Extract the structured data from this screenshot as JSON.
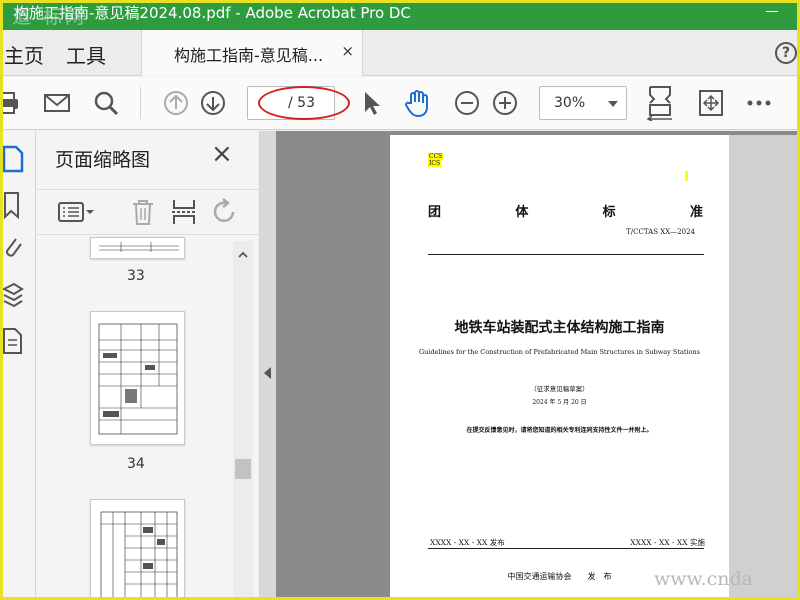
{
  "window": {
    "title": "构施工指南-意见稿2024.08.pdf - Adobe Acrobat Pro DC",
    "watermark_top": "道 标网",
    "title_bar_color": "#2e9c3e"
  },
  "nav": {
    "home_label": "主页",
    "tools_label": "工具",
    "doc_tab_label": "构施工指南-意见稿...",
    "doc_tab_close": "×",
    "help_label": "?"
  },
  "toolbar": {
    "page_current": "",
    "page_total": "/ 53",
    "zoom_value": "30%",
    "icons": [
      "print-icon",
      "email-icon",
      "search-icon",
      "prev-page-icon",
      "next-page-icon",
      "select-cursor-icon",
      "hand-tool-icon",
      "zoom-out-icon",
      "zoom-in-icon",
      "fit-page-icon",
      "full-screen-icon",
      "more-icon"
    ]
  },
  "annotation": {
    "oval_color": "#d42020"
  },
  "left_strip": {
    "icons": [
      "page-thumbnails-icon",
      "bookmark-icon",
      "attachment-icon",
      "layers-icon",
      "document-icon"
    ]
  },
  "thumbnail_panel": {
    "title": "页面缩略图",
    "close": "×",
    "tool_icons": [
      "thumbnail-options-icon",
      "delete-page-icon",
      "insert-page-icon",
      "rotate-page-icon"
    ],
    "pages": [
      {
        "label": "33"
      },
      {
        "label": "34"
      },
      {
        "label": ""
      }
    ]
  },
  "document": {
    "ccs_lines": [
      "CCS",
      "ICS"
    ],
    "standard_type": [
      "团",
      "体",
      "标",
      "准"
    ],
    "standard_code": "T/CCTAS XX—2024",
    "title_cn": "地铁车站装配式主体结构施工指南",
    "title_en": "Guidelines for the Construction of Prefabricated Main Structures in Subway Stations",
    "draft_label": "（征求意见稿草案）",
    "draft_date": "2024 年 5 月 20 日",
    "note": "在提交反馈意见时，请将您知道的相关专利连同支持性文件一并附上。",
    "publish": "XXXX - XX - XX 发布",
    "implement": "XXXX - XX - XX 实施",
    "organization": "中国交通运输协会　　发　布"
  },
  "watermark_bottom": "www.cnda"
}
